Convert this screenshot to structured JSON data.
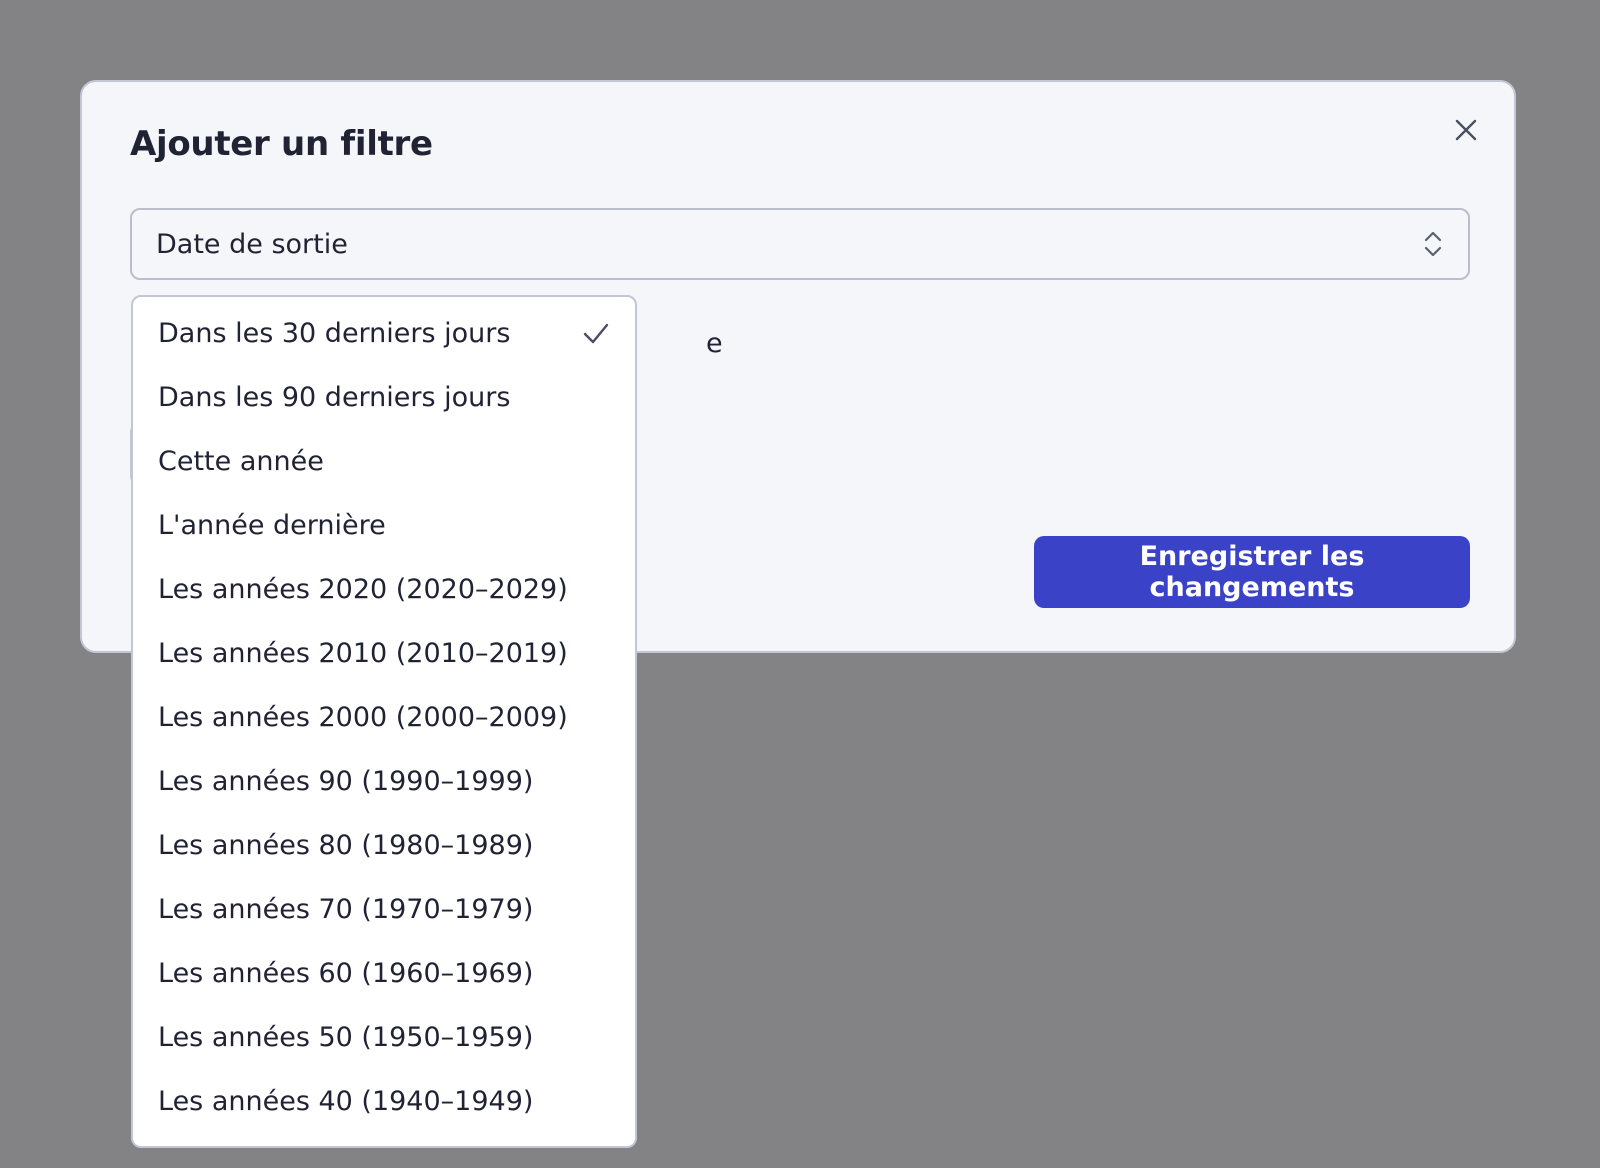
{
  "dialog": {
    "title": "Ajouter un filtre",
    "close_icon": "close-icon",
    "field": {
      "value": "Date de sortie",
      "icon": "chevron-up-down-icon"
    },
    "save_label": "Enregistrer les changements"
  },
  "dropdown": {
    "selected_index": 0,
    "check_icon": "check-icon",
    "options": [
      {
        "label": "Dans les 30 derniers jours",
        "selected": true
      },
      {
        "label": "Dans les 90 derniers jours",
        "selected": false
      },
      {
        "label": "Cette année",
        "selected": false
      },
      {
        "label": "L'année dernière",
        "selected": false
      },
      {
        "label": "Les années 2020 (2020–2029)",
        "selected": false
      },
      {
        "label": "Les années 2010 (2010–2019)",
        "selected": false
      },
      {
        "label": "Les années 2000 (2000–2009)",
        "selected": false
      },
      {
        "label": "Les années 90 (1990–1999)",
        "selected": false
      },
      {
        "label": "Les années 80 (1980–1989)",
        "selected": false
      },
      {
        "label": "Les années 70 (1970–1979)",
        "selected": false
      },
      {
        "label": "Les années 60 (1960–1969)",
        "selected": false
      },
      {
        "label": "Les années 50 (1950–1959)",
        "selected": false
      },
      {
        "label": "Les années 40 (1940–1949)",
        "selected": false
      }
    ]
  },
  "partial_text": "e",
  "colors": {
    "overlay": "#838386",
    "dialog_bg": "#f5f6fa",
    "primary": "#3a43c7",
    "text": "#1f2333",
    "border": "#c3c6d4"
  }
}
